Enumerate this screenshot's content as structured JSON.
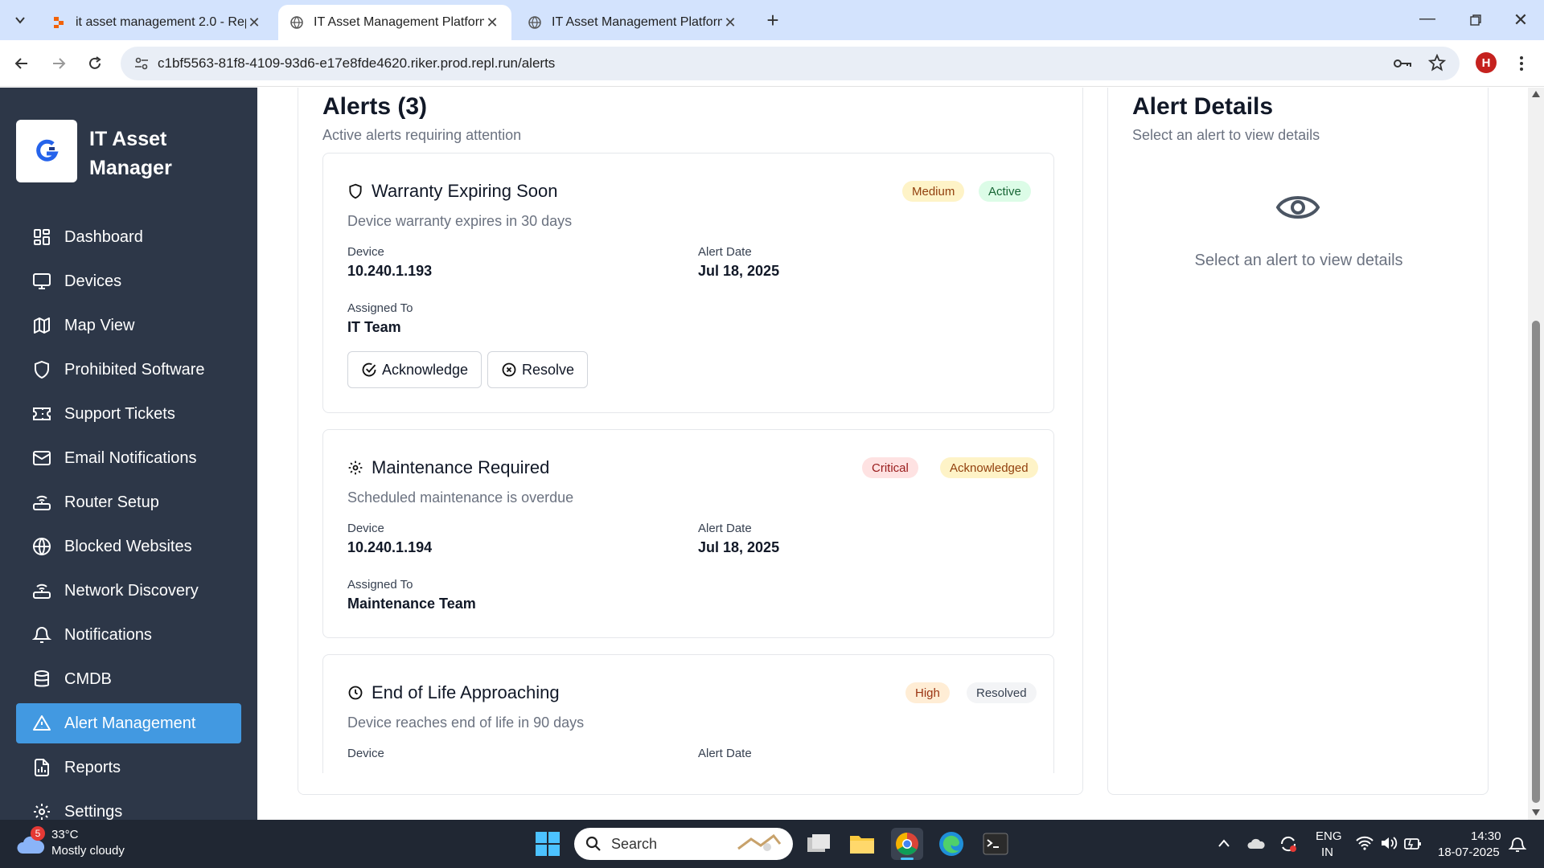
{
  "browser": {
    "tabs": [
      {
        "title": "it asset management 2.0 - Repl"
      },
      {
        "title": "IT Asset Management Platform"
      },
      {
        "title": "IT Asset Management Platform"
      }
    ],
    "url": "c1bf5563-81f8-4109-93d6-e17e8fde4620.riker.prod.repl.run/alerts",
    "profile_initial": "H"
  },
  "sidebar": {
    "app_name": "IT Asset Manager",
    "items": [
      {
        "label": "Dashboard",
        "icon": "grid-icon"
      },
      {
        "label": "Devices",
        "icon": "monitor-icon"
      },
      {
        "label": "Map View",
        "icon": "map-icon"
      },
      {
        "label": "Prohibited Software",
        "icon": "shield-icon"
      },
      {
        "label": "Support Tickets",
        "icon": "ticket-icon"
      },
      {
        "label": "Email Notifications",
        "icon": "mail-icon"
      },
      {
        "label": "Router Setup",
        "icon": "router-icon"
      },
      {
        "label": "Blocked Websites",
        "icon": "globe-icon"
      },
      {
        "label": "Network Discovery",
        "icon": "router-icon"
      },
      {
        "label": "Notifications",
        "icon": "bell-icon"
      },
      {
        "label": "CMDB",
        "icon": "database-icon"
      },
      {
        "label": "Alert Management",
        "icon": "alert-triangle-icon",
        "active": true
      },
      {
        "label": "Reports",
        "icon": "file-chart-icon"
      },
      {
        "label": "Settings",
        "icon": "gear-icon"
      }
    ]
  },
  "alerts_panel": {
    "title": "Alerts (3)",
    "subtitle": "Active alerts requiring attention",
    "device_label": "Device",
    "date_label": "Alert Date",
    "assigned_label": "Assigned To",
    "acknowledge_label": "Acknowledge",
    "resolve_label": "Resolve",
    "alerts": [
      {
        "title": "Warranty Expiring Soon",
        "description": "Device warranty expires in 30 days",
        "severity": "Medium",
        "status": "Active",
        "device": "10.240.1.193",
        "date": "Jul 18, 2025",
        "assigned": "IT Team",
        "icon": "shield-icon"
      },
      {
        "title": "Maintenance Required",
        "description": "Scheduled maintenance is overdue",
        "severity": "Critical",
        "status": "Acknowledged",
        "device": "10.240.1.194",
        "date": "Jul 18, 2025",
        "assigned": "Maintenance Team",
        "icon": "gear-icon"
      },
      {
        "title": "End of Life Approaching",
        "description": "Device reaches end of life in 90 days",
        "severity": "High",
        "status": "Resolved",
        "icon": "clock-icon"
      }
    ]
  },
  "details_panel": {
    "title": "Alert Details",
    "subtitle": "Select an alert to view details",
    "empty_message": "Select an alert to view details"
  },
  "taskbar": {
    "weather_temp": "33°C",
    "weather_desc": "Mostly cloudy",
    "weather_badge": "5",
    "search_placeholder": "Search",
    "lang": "ENG",
    "region": "IN",
    "time": "14:30",
    "date": "18-07-2025"
  },
  "colors": {
    "sidebar_bg": "#2d3748",
    "sidebar_active": "#4299e1",
    "badge_medium": "#fef3c7",
    "badge_active": "#dcfce7",
    "badge_critical": "#fee2e2",
    "badge_high": "#ffedd5",
    "badge_resolved": "#f3f4f6"
  }
}
